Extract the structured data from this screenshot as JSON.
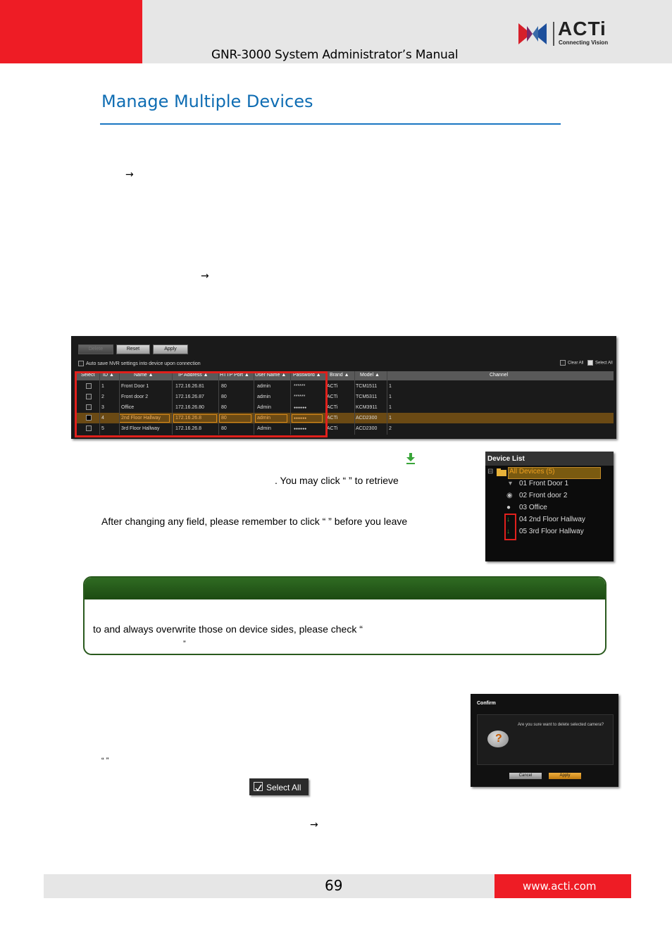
{
  "header": {
    "title": "GNR-3000 System Administrator’s Manual",
    "brand": "ACTi",
    "brand_tagline": "Connecting Vision"
  },
  "section": {
    "title": "Manage Multiple Devices"
  },
  "arrows": {
    "a1": "→",
    "a2": "→",
    "a3": "→"
  },
  "device_table": {
    "buttons": {
      "delete": "Delete",
      "reset": "Reset",
      "apply": "Apply"
    },
    "auto_save": "Auto save NVR settings into device upon connection",
    "clear_all": "Clear All",
    "select_all": "Select All",
    "columns": [
      "Select",
      "ID ▲",
      "Name ▲",
      "IP Address ▲",
      "HTTP Port ▲",
      "User Name ▲",
      "Password ▲",
      "Brand ▲",
      "Model ▲",
      "Channel"
    ],
    "rows": [
      {
        "id": "1",
        "name": "Front Door 1",
        "ip": "172.16.26.81",
        "port": "80",
        "user": "admin",
        "password": "******",
        "brand": "ACTi",
        "model": "TCM1511",
        "channel": "1"
      },
      {
        "id": "2",
        "name": "Front door 2",
        "ip": "172.16.26.87",
        "port": "80",
        "user": "admin",
        "password": "******",
        "brand": "ACTi",
        "model": "TCM5311",
        "channel": "1"
      },
      {
        "id": "3",
        "name": "Office",
        "ip": "172.16.26.80",
        "port": "80",
        "user": "Admin",
        "password": "●●●●●●",
        "brand": "ACTi",
        "model": "KCM3911",
        "channel": "1"
      },
      {
        "id": "4",
        "name": "2nd Floor Hallway",
        "ip": "172.16.26.8",
        "port": "80",
        "user": "admin",
        "password": "●●●●●●",
        "brand": "ACTi",
        "model": "ACD2300",
        "channel": "1"
      },
      {
        "id": "5",
        "name": "3rd Floor Hallway",
        "ip": "172.16.26.8",
        "port": "80",
        "user": "Admin",
        "password": "●●●●●●",
        "brand": "ACTi",
        "model": "ACD2300",
        "channel": "2"
      }
    ]
  },
  "device_list": {
    "title": "Device List",
    "root": "All Devices (5)",
    "items": [
      "01  Front Door 1",
      "02  Front door 2",
      "03  Office",
      "04  2nd Floor Hallway",
      "05  3rd Floor Hallway"
    ]
  },
  "text": {
    "line1": ". You  may  click  “            ”  to  retrieve",
    "line2": "After changing any field, please remember to click “            ” before you leave",
    "note_line1": "to and always overwrite those on device sides, please check “",
    "note_line2": "”",
    "quote_line": "“            ”"
  },
  "confirm": {
    "title": "Confirm",
    "message": "Are you sure want to delete  selected camera?",
    "cancel": "Cancel",
    "apply": "Apply"
  },
  "select_all_btn": "Select All",
  "footer": {
    "page": "69",
    "url": "www.acti.com"
  }
}
